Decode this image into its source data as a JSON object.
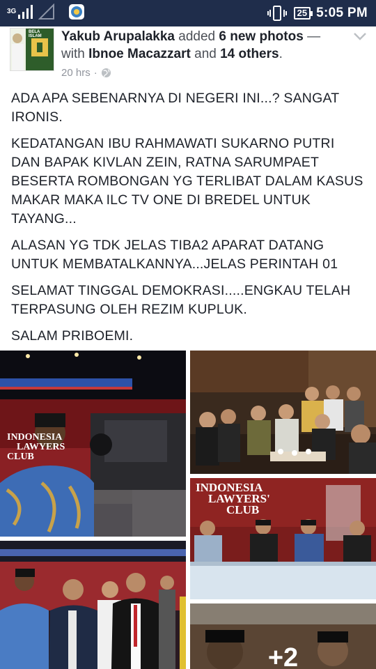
{
  "status_bar": {
    "network": "3G",
    "battery": "25",
    "time": "5:05 PM"
  },
  "post": {
    "author": "Yakub Arupalakka",
    "action": "added",
    "photo_count": "6 new photos",
    "with_text": "— with",
    "tagged": "Ibnoe Macazzart",
    "and_text": "and",
    "others": "14 others",
    "period": ".",
    "time": "20 hrs",
    "separator": "·",
    "avatar_text": "BELA ISLAM",
    "paragraphs": [
      "ADA APA SEBENARNYA DI NEGERI INI...? SANGAT IRONIS.",
      "KEDATANGAN IBU RAHMAWATI SUKARNO PUTRI DAN BAPAK KIVLAN ZEIN, RATNA SARUMPAET BESERTA ROMBONGAN YG TERLIBAT DALAM KASUS MAKAR MAKA ILC TV ONE DI BREDEL UNTUK TAYANG...",
      "ALASAN YG TDK JELAS TIBA2 APARAT DATANG UNTUK MEMBATALKANNYA...JELAS PERINTAH 01",
      "SELAMAT TINGGAL DEMOKRASI.....ENGKAU TELAH TERPASUNG OLEH REZIM KUPLUK.",
      "SALAM PRIBOEMI."
    ]
  },
  "photos": {
    "studio_sign": [
      "INDONESIA",
      "LAWYERS",
      "CLUB"
    ],
    "panel_sign": [
      "INDONESIA",
      "LAWYERS'",
      "CLUB"
    ],
    "more_count": "+2"
  }
}
